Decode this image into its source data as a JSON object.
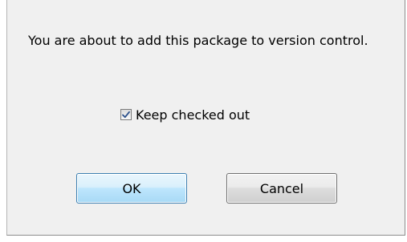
{
  "dialog": {
    "message": "You are about to add this package to version control.",
    "checkbox": {
      "label": "Keep checked out",
      "checked": true
    },
    "buttons": {
      "ok_label": "OK",
      "cancel_label": "Cancel"
    }
  },
  "colors": {
    "dialog_background": "#f0f0f0",
    "ok_border": "#3c7fb1",
    "checkmark": "#2a4f8a"
  },
  "icons": {
    "checkbox_mark": "checkmark-icon"
  }
}
